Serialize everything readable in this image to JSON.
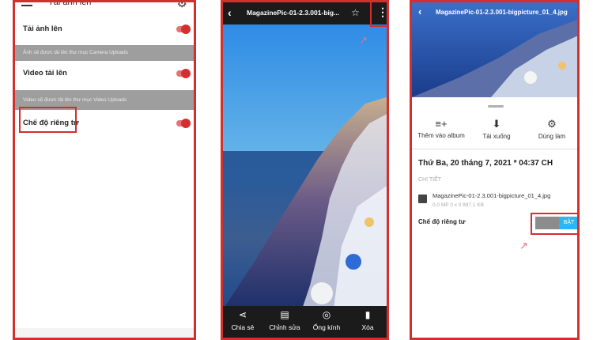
{
  "panel1": {
    "title": "Tải ảnh lên",
    "rows": [
      {
        "label": "Tải ảnh lên",
        "desc": "Ảnh sẽ được tải lên thư mục Camera Uploads"
      },
      {
        "label": "Video tải lên",
        "desc": "Video sẽ được tải lên thư mục Video Uploads"
      },
      {
        "label": "Chế độ riêng tư"
      }
    ]
  },
  "panel2": {
    "title": "MagazinePic-01-2.3.001-big...",
    "actions": [
      {
        "label": "Chia sẻ",
        "icon": "share-icon"
      },
      {
        "label": "Chỉnh sửa",
        "icon": "edit-icon"
      },
      {
        "label": "Ống kính",
        "icon": "lens-icon"
      },
      {
        "label": "Xóa",
        "icon": "trash-icon"
      }
    ]
  },
  "panel3": {
    "title": "MagazinePic-01-2.3.001-bigpicture_01_4.jpg",
    "actions": [
      {
        "label": "Thêm vào album",
        "icon": "playlist-add-icon"
      },
      {
        "label": "Tải xuống",
        "icon": "download-icon"
      },
      {
        "label": "Dùng làm",
        "icon": "gear-icon"
      }
    ],
    "date": "Thứ Ba, 20 tháng 7, 2021 * 04:37 CH",
    "section": "CHI TIẾT",
    "file_name": "MagazinePic-01-2.3.001-bigpicture_01_4.jpg",
    "file_meta": "0,0 MP    0 x 0    897,1 KB",
    "privacy_label": "Chế độ riêng tư",
    "toggle_label": "BẬT"
  },
  "colors": {
    "accent": "#d32f2f",
    "toggle_on": "#29b6f6"
  }
}
